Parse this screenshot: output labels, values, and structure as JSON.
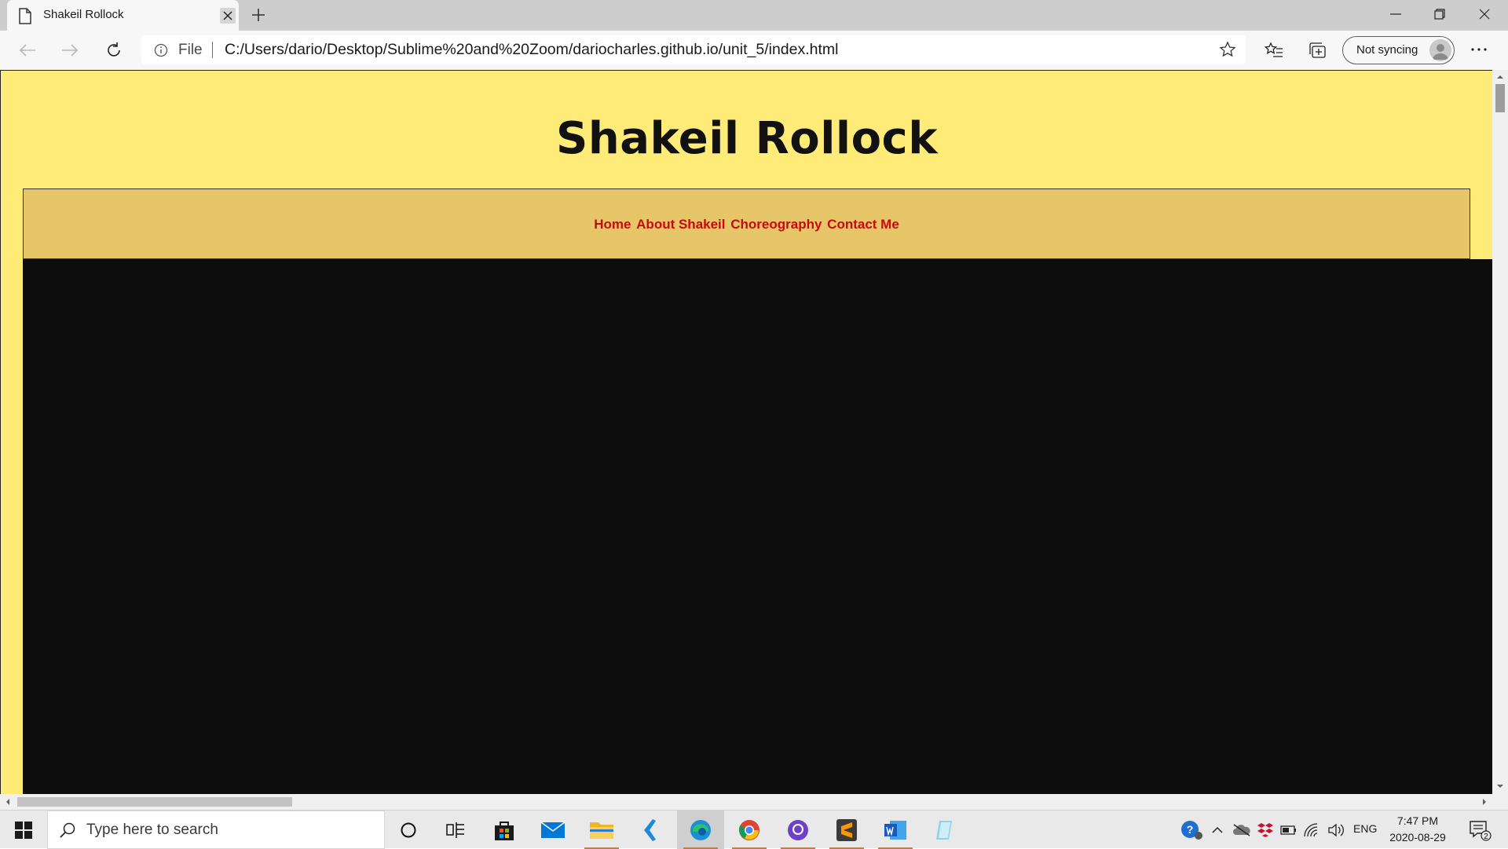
{
  "browser": {
    "tab_title": "Shakeil Rollock",
    "address_scheme": "File",
    "address_url": "C:/Users/dario/Desktop/Sublime%20and%20Zoom/dariocharles.github.io/unit_5/index.html",
    "sync_label": "Not syncing"
  },
  "page": {
    "title": "Shakeil Rollock",
    "nav": [
      "Home",
      "About Shakeil",
      "Choreography",
      "Contact Me"
    ],
    "colors": {
      "background": "#ffec78",
      "nav_background": "#e7c66a",
      "nav_link": "#c80a0a",
      "hero": "#0d0d0d"
    }
  },
  "taskbar": {
    "search_placeholder": "Type here to search",
    "language": "ENG",
    "time": "7:47 PM",
    "date": "2020-08-29",
    "notification_count": "2",
    "apps": [
      "cortana-icon",
      "task-view-icon",
      "store-icon",
      "mail-icon",
      "file-explorer-icon",
      "visual-studio-icon",
      "edge-icon",
      "chrome-icon",
      "github-icon",
      "sublime-icon",
      "word-icon",
      "notepad-icon"
    ]
  }
}
